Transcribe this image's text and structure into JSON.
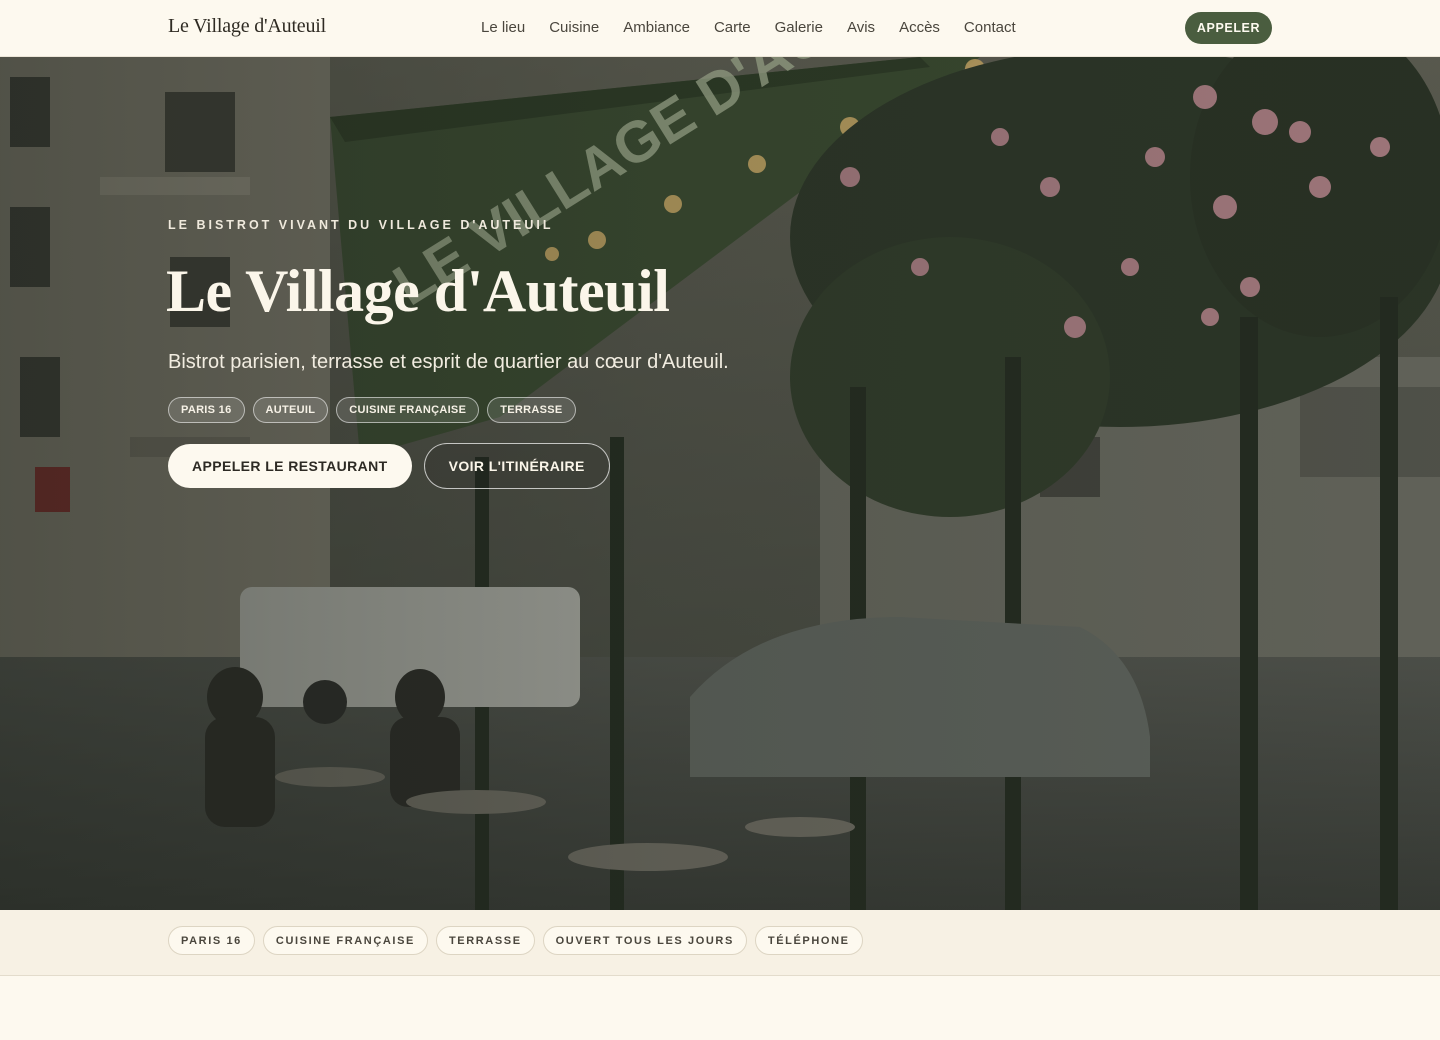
{
  "header": {
    "brand": "Le Village d'Auteuil",
    "nav": [
      "Le lieu",
      "Cuisine",
      "Ambiance",
      "Carte",
      "Galerie",
      "Avis",
      "Accès",
      "Contact"
    ],
    "call_label": "APPELER"
  },
  "hero": {
    "eyebrow": "LE BISTROT VIVANT DU VILLAGE D'AUTEUIL",
    "title": "Le Village d'Auteuil",
    "subtitle": "Bistrot parisien, terrasse et esprit de quartier au cœur d'Auteuil.",
    "chips": [
      "PARIS 16",
      "AUTEUIL",
      "CUISINE FRANÇAISE",
      "TERRASSE"
    ],
    "primary_cta": "APPELER LE RESTAURANT",
    "secondary_cta": "VOIR L'ITINÉRAIRE",
    "image_subject": "Terrasse du bistrot avec store vert et rosiers grimpants"
  },
  "tagbar": {
    "tags": [
      "PARIS 16",
      "CUISINE FRANÇAISE",
      "TERRASSE",
      "OUVERT TOUS LES JOURS",
      "TÉLÉPHONE"
    ]
  },
  "colors": {
    "background": "#fdf9ef",
    "accent_green": "#4a5d3f",
    "tagbar_bg": "#f7f1e4"
  }
}
